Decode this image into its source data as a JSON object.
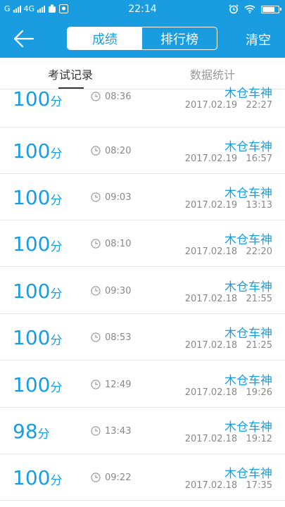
{
  "status_bar": {
    "carrier": "G",
    "network": "4G",
    "time": "22:14"
  },
  "header": {
    "tabs": [
      "成绩",
      "排行榜"
    ],
    "active_tab": "成绩",
    "action": "清空"
  },
  "sub_tabs": {
    "items": [
      "考试记录",
      "数据统计"
    ],
    "active": "考试记录"
  },
  "records": [
    {
      "score": "100",
      "unit": "分",
      "duration": "08:36",
      "user": "木仓车神",
      "datetime": "2017.02.19   22:27"
    },
    {
      "score": "100",
      "unit": "分",
      "duration": "08:20",
      "user": "木仓车神",
      "datetime": "2017.02.19   16:57"
    },
    {
      "score": "100",
      "unit": "分",
      "duration": "09:03",
      "user": "木仓车神",
      "datetime": "2017.02.19   13:13"
    },
    {
      "score": "100",
      "unit": "分",
      "duration": "08:10",
      "user": "木仓车神",
      "datetime": "2017.02.18   22:20"
    },
    {
      "score": "100",
      "unit": "分",
      "duration": "09:30",
      "user": "木仓车神",
      "datetime": "2017.02.18   21:55"
    },
    {
      "score": "100",
      "unit": "分",
      "duration": "08:53",
      "user": "木仓车神",
      "datetime": "2017.02.18   21:25"
    },
    {
      "score": "100",
      "unit": "分",
      "duration": "12:49",
      "user": "木仓车神",
      "datetime": "2017.02.18   19:26"
    },
    {
      "score": "98",
      "unit": "分",
      "duration": "13:43",
      "user": "木仓车神",
      "datetime": "2017.02.18   19:12"
    },
    {
      "score": "100",
      "unit": "分",
      "duration": "09:22",
      "user": "木仓车神",
      "datetime": "2017.02.18   17:35"
    }
  ],
  "colors": {
    "accent": "#1a9de0",
    "secondary_text": "#888888"
  }
}
